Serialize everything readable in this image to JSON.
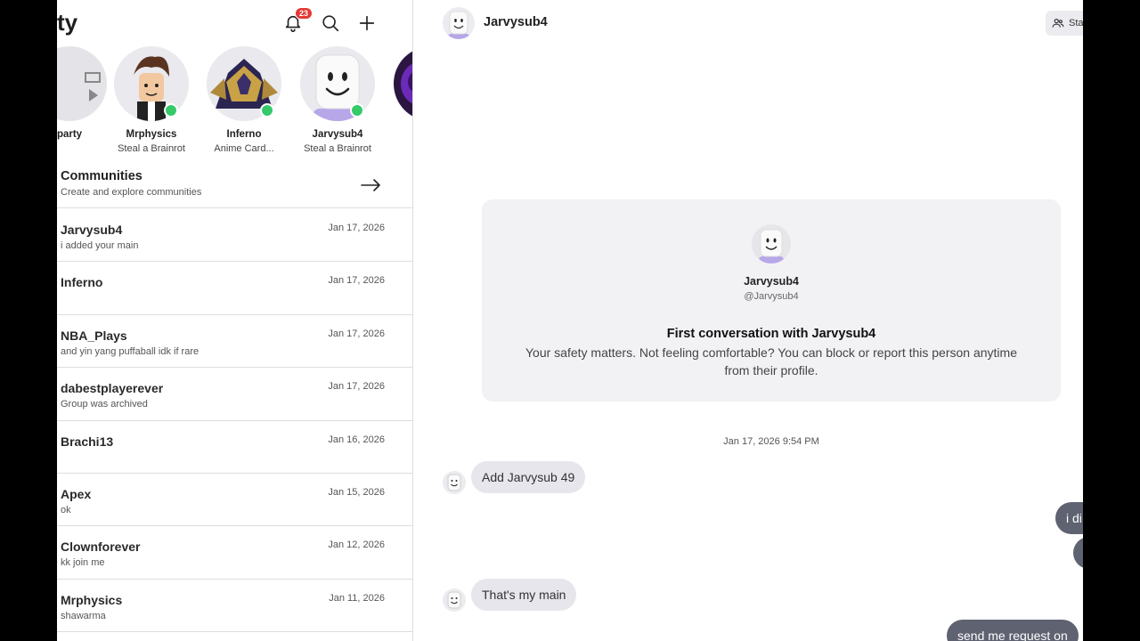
{
  "left": {
    "title": "ty",
    "notification_count": "23",
    "friends": [
      {
        "name": "party",
        "game": ""
      },
      {
        "name": "Mrphysics",
        "game": "Steal a Brainrot"
      },
      {
        "name": "Inferno",
        "game": "Anime Card..."
      },
      {
        "name": "Jarvysub4",
        "game": "Steal a Brainrot"
      }
    ],
    "communities": {
      "title": "Communities",
      "subtitle": "Create and explore communities"
    },
    "chats": [
      {
        "name": "Jarvysub4",
        "message": "i added your main",
        "date": "Jan 17, 2026"
      },
      {
        "name": "Inferno",
        "message": "",
        "date": "Jan 17, 2026"
      },
      {
        "name": "NBA_Plays",
        "message": "and yin yang puffaball idk if rare",
        "date": "Jan 17, 2026"
      },
      {
        "name": "dabestplayerever",
        "message": "Group was archived",
        "date": "Jan 17, 2026"
      },
      {
        "name": "Brachi13",
        "message": "",
        "date": "Jan 16, 2026"
      },
      {
        "name": "Apex",
        "message": "ok",
        "date": "Jan 15, 2026"
      },
      {
        "name": "Clownforever",
        "message": "kk join me",
        "date": "Jan 12, 2026"
      },
      {
        "name": "Mrphysics",
        "message": "shawarma",
        "date": "Jan 11, 2026"
      }
    ]
  },
  "conversation": {
    "header_name": "Jarvysub4",
    "status_label": "Sta",
    "safety": {
      "name": "Jarvysub4",
      "handle": "@Jarvysub4",
      "title": "First conversation with Jarvysub4",
      "body": "Your safety matters. Not feeling comfortable? You can block or report this person anytime from their profile."
    },
    "timestamp": "Jan 17, 2026 9:54 PM",
    "messages": [
      {
        "direction": "in",
        "text": "Add Jarvysub 49"
      },
      {
        "direction": "out",
        "text": "i di"
      },
      {
        "direction": "out",
        "text": ""
      },
      {
        "direction": "in",
        "text": "That's my main"
      },
      {
        "direction": "out",
        "text": "send me request on"
      }
    ]
  },
  "colors": {
    "online": "#35c96a",
    "badge": "#e53935",
    "outgoing_bubble": "#5e6271",
    "incoming_bubble": "#e6e6ec",
    "card_background": "#f2f2f5"
  }
}
